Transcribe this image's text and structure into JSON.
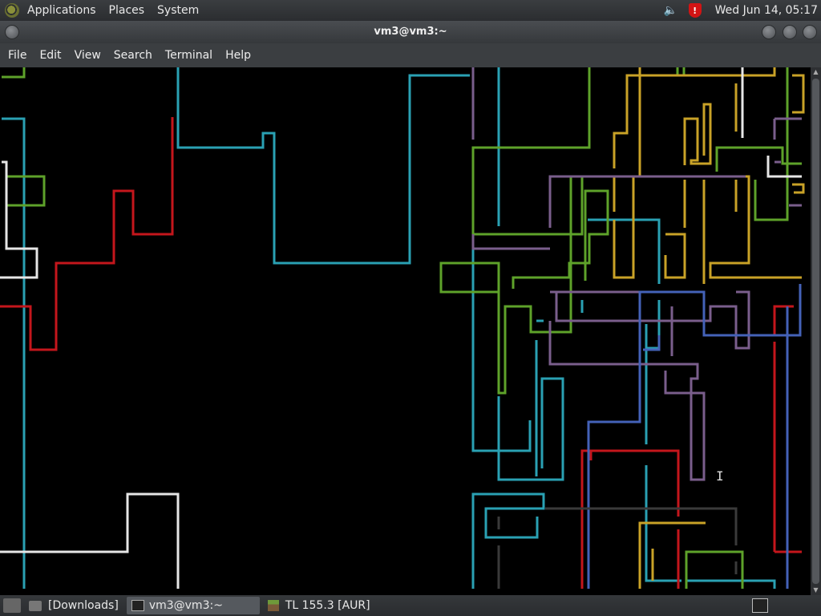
{
  "top_panel": {
    "menus": [
      "Applications",
      "Places",
      "System"
    ],
    "clock": "Wed Jun 14, 05:17",
    "tray": [
      "volume-icon",
      "shield-icon"
    ]
  },
  "window": {
    "title": "vm3@vm3:~",
    "menubar": [
      "File",
      "Edit",
      "View",
      "Search",
      "Terminal",
      "Help"
    ]
  },
  "terminal": {
    "content": "pipes screensaver animation",
    "colors": {
      "cyan": "#2aa1b3",
      "green": "#5ea22a",
      "yellow": "#c9a227",
      "red": "#c4161c",
      "white": "#e6e6e6",
      "purple": "#7a5e8c",
      "blue": "#4462b8",
      "gray": "#3a3a3a"
    }
  },
  "taskbar": {
    "items": [
      {
        "label": "[Downloads]",
        "active": false
      },
      {
        "label": "vm3@vm3:~",
        "active": true
      },
      {
        "label": "TL 155.3 [AUR]",
        "active": false
      }
    ]
  }
}
